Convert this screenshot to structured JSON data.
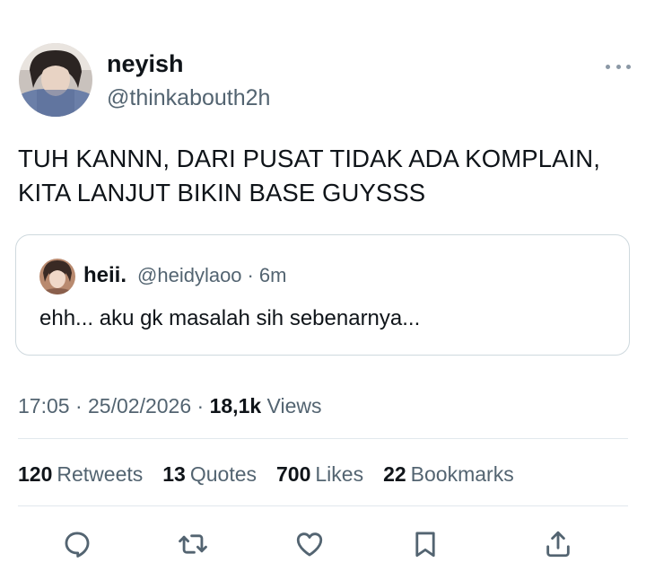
{
  "author": {
    "display_name": "neyish",
    "handle": "@thinkabouth2h"
  },
  "tweet": {
    "text": "TUH KANNN, DARI PUSAT TIDAK ADA KOMPLAIN,\nKITA LANJUT BIKIN BASE GUYSSS"
  },
  "quote": {
    "display_name": "heii.",
    "handle": "@heidylaoo",
    "separator": "·",
    "time": "6m",
    "text": "ehh... aku gk masalah sih sebenarnya..."
  },
  "meta": {
    "time": "17:05",
    "separator": "·",
    "date": "25/02/2026",
    "views_count": "18,1k",
    "views_label": "Views"
  },
  "stats": {
    "retweets": {
      "count": "120",
      "label": "Retweets"
    },
    "quotes": {
      "count": "13",
      "label": "Quotes"
    },
    "likes": {
      "count": "700",
      "label": "Likes"
    },
    "bookmarks": {
      "count": "22",
      "label": "Bookmarks"
    }
  },
  "icons": {
    "more": "more-icon",
    "reply": "reply-icon",
    "retweet": "retweet-icon",
    "like": "heart-icon",
    "bookmark": "bookmark-icon",
    "share": "share-icon"
  },
  "colors": {
    "text_primary": "#0f1419",
    "text_secondary": "#536471",
    "border": "#cfd9de",
    "divider": "#e1e8ed"
  }
}
